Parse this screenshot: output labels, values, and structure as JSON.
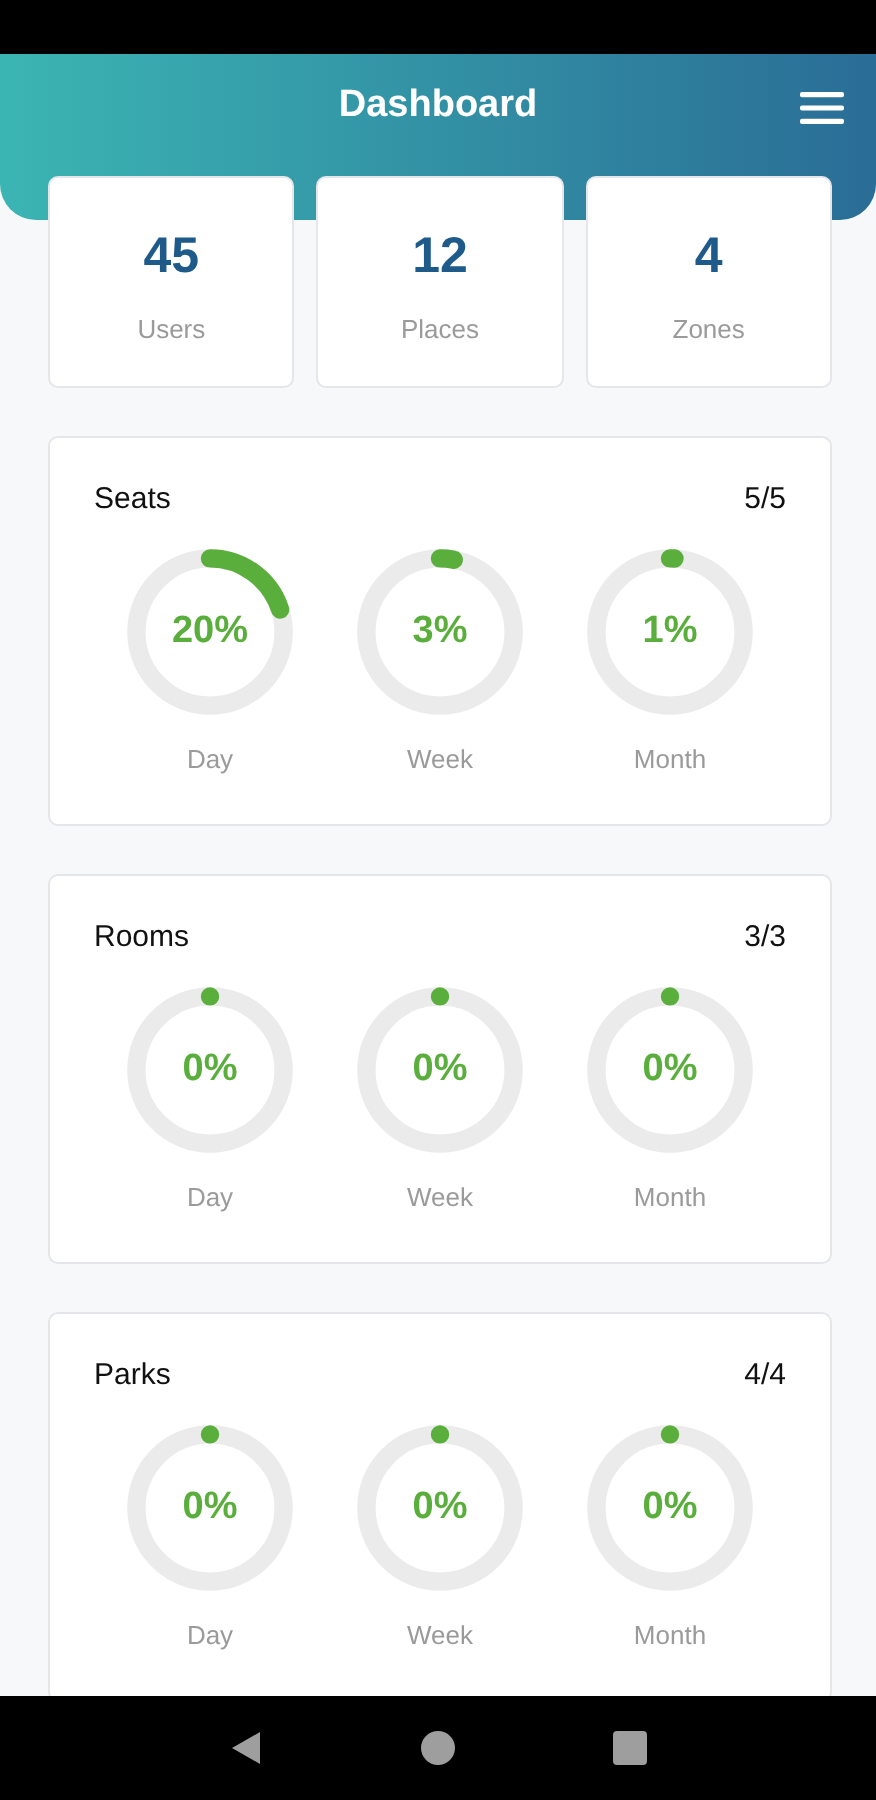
{
  "header": {
    "title": "Dashboard"
  },
  "stats": [
    {
      "value": "45",
      "label": "Users"
    },
    {
      "value": "12",
      "label": "Places"
    },
    {
      "value": "4",
      "label": "Zones"
    }
  ],
  "sections": [
    {
      "title": "Seats",
      "count": "5/5",
      "rings": [
        {
          "reading": "20%",
          "level": 0.2,
          "label": "Day"
        },
        {
          "reading": "3%",
          "level": 0.03,
          "label": "Week"
        },
        {
          "reading": "1%",
          "level": 0.01,
          "label": "Month"
        }
      ]
    },
    {
      "title": "Rooms",
      "count": "3/3",
      "rings": [
        {
          "reading": "0%",
          "level": 0,
          "label": "Day"
        },
        {
          "reading": "0%",
          "level": 0,
          "label": "Week"
        },
        {
          "reading": "0%",
          "level": 0,
          "label": "Month"
        }
      ]
    },
    {
      "title": "Parks",
      "count": "4/4",
      "rings": [
        {
          "reading": "0%",
          "level": 0,
          "label": "Day"
        },
        {
          "reading": "0%",
          "level": 0,
          "label": "Week"
        },
        {
          "reading": "0%",
          "level": 0,
          "label": "Month"
        }
      ]
    }
  ]
}
